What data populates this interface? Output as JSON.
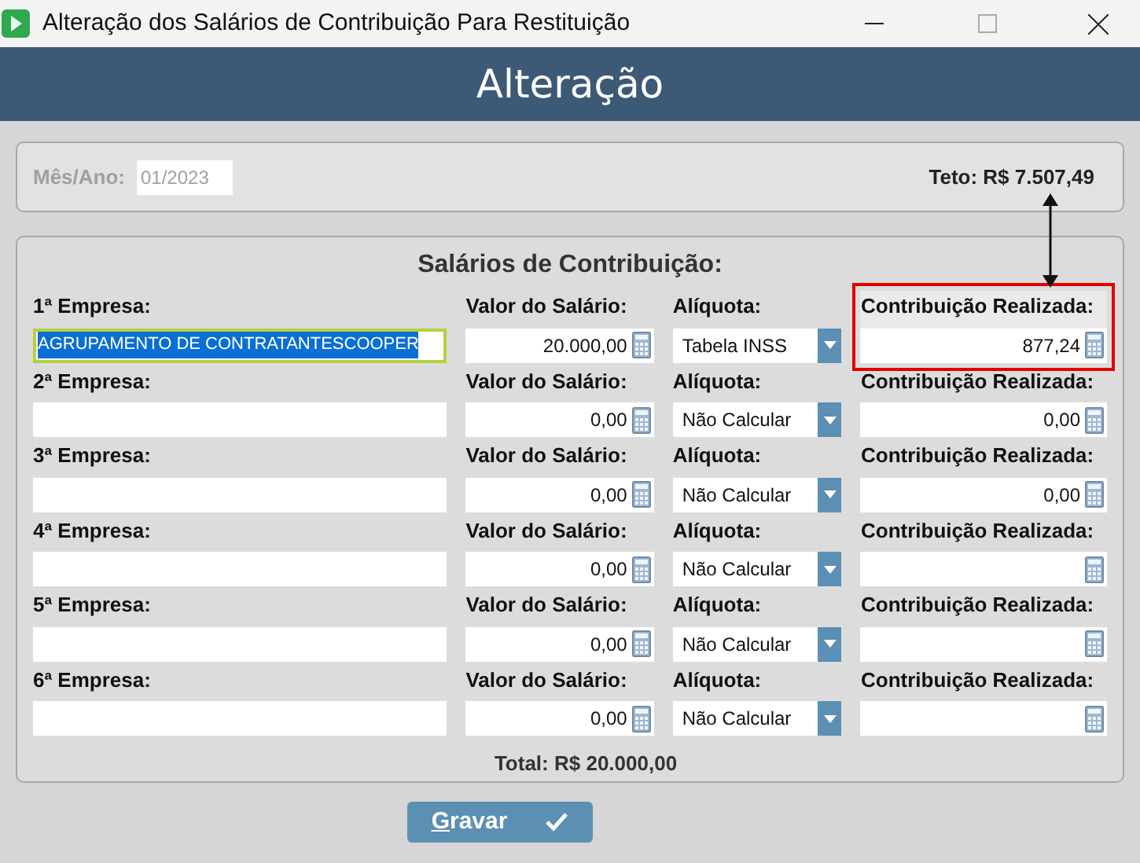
{
  "window": {
    "title": "Alteração dos Salários de Contribuição Para Restituição"
  },
  "header": {
    "title": "Alteração"
  },
  "period": {
    "label": "Mês/Ano:",
    "value": "01/2023",
    "disabled": true,
    "ceiling": "Teto: R$ 7.507,49"
  },
  "group": {
    "title": "Salários de Contribuição:",
    "total": "Total: R$ 20.000,00",
    "rows": [
      {
        "company_label": "1ª Empresa:",
        "company": "AGRUPAMENTO DE CONTRATANTESCOOPER",
        "text_selected": true,
        "salary_label": "Valor do Salário:",
        "salary": "20.000,00",
        "rate_label": "Alíquota:",
        "rate": "Tabela INSS",
        "contribution_label": "Contribuição Realizada:",
        "contribution": "877,24",
        "highlighted": true
      },
      {
        "company_label": "2ª Empresa:",
        "company": "",
        "text_selected": false,
        "salary_label": "Valor do Salário:",
        "salary": "0,00",
        "rate_label": "Alíquota:",
        "rate": "Não Calcular",
        "contribution_label": "Contribuição Realizada:",
        "contribution": "0,00",
        "highlighted": false
      },
      {
        "company_label": "3ª Empresa:",
        "company": "",
        "text_selected": false,
        "salary_label": "Valor do Salário:",
        "salary": "0,00",
        "rate_label": "Alíquota:",
        "rate": "Não Calcular",
        "contribution_label": "Contribuição Realizada:",
        "contribution": "0,00",
        "highlighted": false
      },
      {
        "company_label": "4ª Empresa:",
        "company": "",
        "text_selected": false,
        "salary_label": "Valor do Salário:",
        "salary": "0,00",
        "rate_label": "Alíquota:",
        "rate": "Não Calcular",
        "contribution_label": "Contribuição Realizada:",
        "contribution": "",
        "highlighted": false
      },
      {
        "company_label": "5ª Empresa:",
        "company": "",
        "text_selected": false,
        "salary_label": "Valor do Salário:",
        "salary": "0,00",
        "rate_label": "Alíquota:",
        "rate": "Não Calcular",
        "contribution_label": "Contribuição Realizada:",
        "contribution": "",
        "highlighted": false
      },
      {
        "company_label": "6ª Empresa:",
        "company": "",
        "text_selected": false,
        "salary_label": "Valor do Salário:",
        "salary": "0,00",
        "rate_label": "Alíquota:",
        "rate": "Não Calcular",
        "contribution_label": "Contribuição Realizada:",
        "contribution": "",
        "highlighted": false
      }
    ]
  },
  "save_button": {
    "label": "Gravar"
  }
}
